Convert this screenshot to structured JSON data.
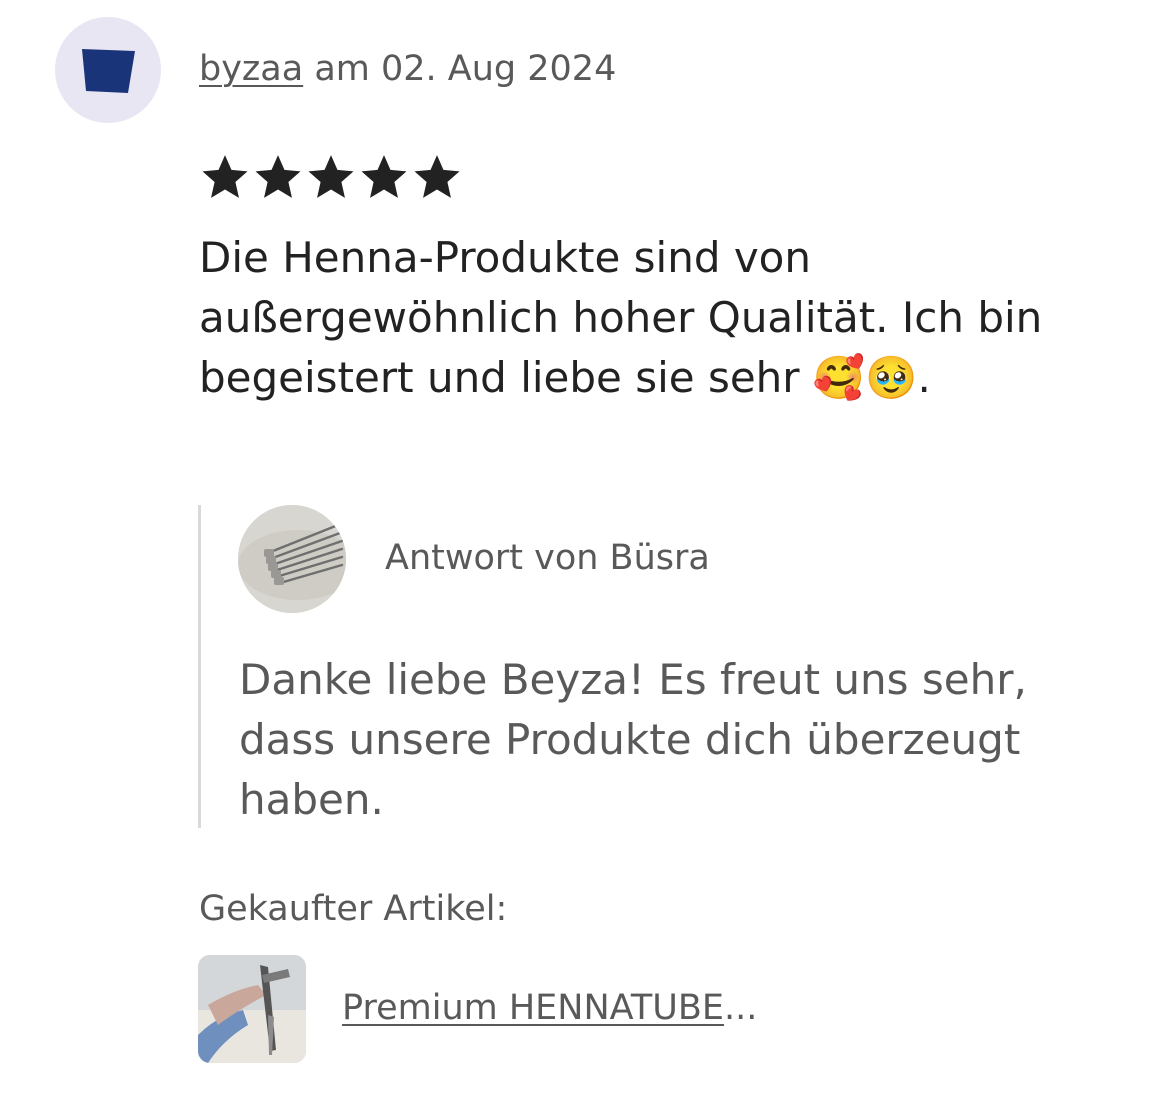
{
  "review": {
    "username": "byzaa",
    "date_text": "am 02. Aug 2024",
    "rating": 5,
    "rating_max": 5,
    "text": "Die Henna-Produkte sind von außergewöhnlich hoher Qualität. Ich bin begeistert und liebe sie sehr 🥰🥹.",
    "avatar_color": "#1a347a"
  },
  "reply": {
    "from_label": "Antwort von Büsra",
    "text": "Danke liebe Beyza! Es freut uns sehr, dass unsere Produkte dich überzeugt haben."
  },
  "purchase": {
    "label": "Gekaufter Artikel:",
    "item_title": "Premium HENNATUBE",
    "ellipsis": "..."
  },
  "colors": {
    "text": "#222222",
    "muted": "#595959",
    "divider": "#d9d9d9",
    "avatar_bg": "#e8e6f3"
  }
}
